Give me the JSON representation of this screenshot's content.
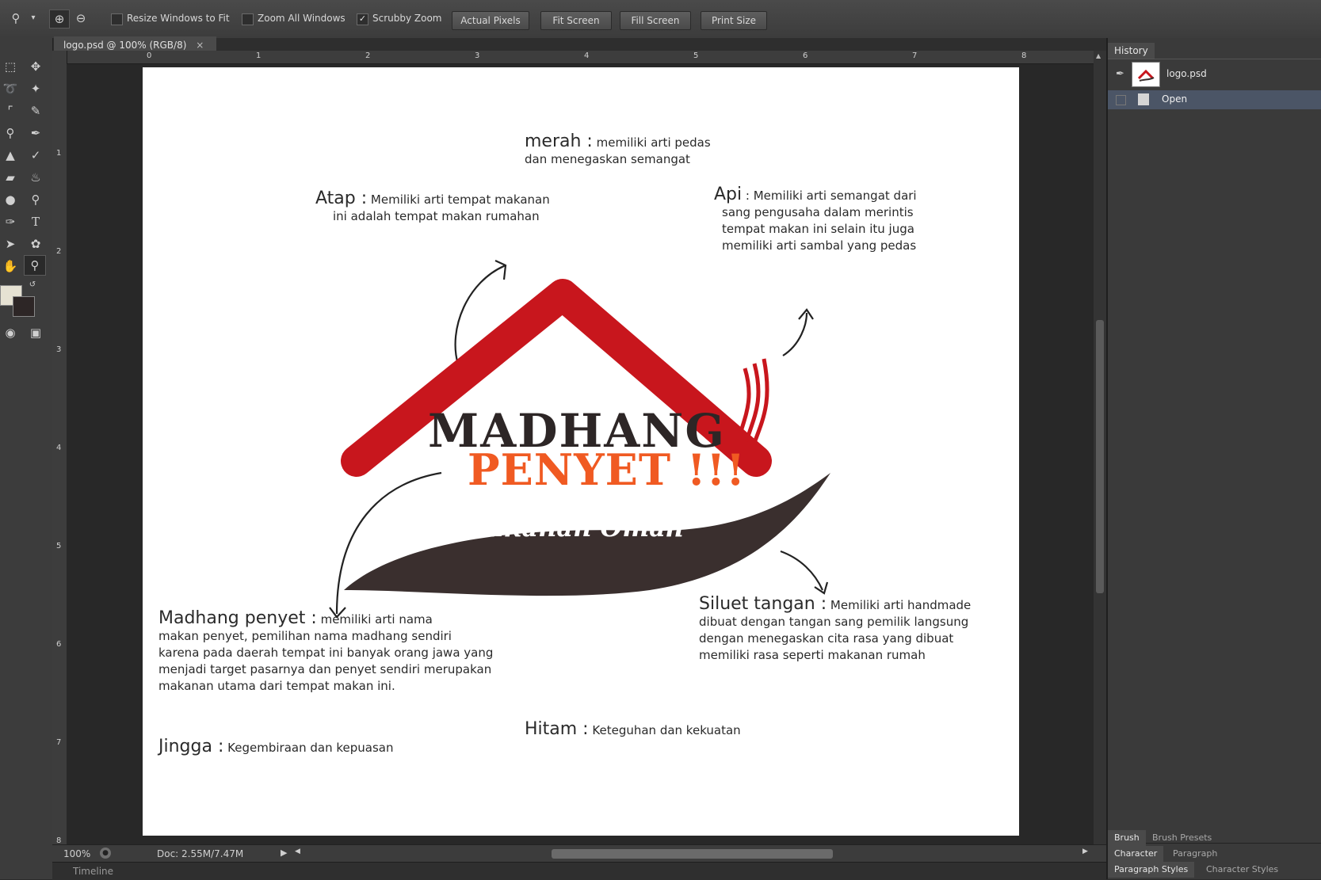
{
  "options_bar": {
    "resize_windows_label": "Resize Windows to Fit",
    "zoom_all_label": "Zoom All Windows",
    "scrubby_zoom_label": "Scrubby Zoom",
    "actual_pixels": "Actual Pixels",
    "fit_screen": "Fit Screen",
    "fill_screen": "Fill Screen",
    "print_size": "Print Size"
  },
  "document_tab": {
    "title": "logo.psd @ 100% (RGB/8)",
    "close": "×"
  },
  "ruler": {
    "h": [
      "0",
      "1",
      "2",
      "3",
      "4",
      "5",
      "6",
      "7",
      "8"
    ],
    "v": [
      "1",
      "2",
      "3",
      "4",
      "5",
      "6",
      "7",
      "8"
    ]
  },
  "status": {
    "zoom": "100%",
    "doc_size": "Doc: 2.55M/7.47M"
  },
  "timeline_label": "Timeline",
  "history": {
    "title": "History",
    "snapshot_name": "logo.psd",
    "state": "Open"
  },
  "bottom_panels": {
    "brush": "Brush",
    "brush_presets": "Brush Presets",
    "character": "Character",
    "paragraph": "Paragraph",
    "paragraph_styles": "Paragraph Styles",
    "character_styles": "Character Styles"
  },
  "logo": {
    "line1": "MADHANG",
    "line2": "PENYET !!!",
    "tagline": "Makanan Omah"
  },
  "annotations": {
    "merah_head": "merah :",
    "merah_l1": "memiliki arti pedas",
    "merah_l2": "dan menegaskan semangat",
    "atap_head": "Atap :",
    "atap_l1": "Memiliki arti tempat makanan",
    "atap_l2": "ini adalah tempat makan rumahan",
    "api_head": "Api",
    "api_l1": ": Memiliki arti semangat dari",
    "api_l2": "sang pengusaha dalam merintis",
    "api_l3": "tempat makan ini selain itu juga",
    "api_l4": "memiliki arti sambal yang pedas",
    "madhang_head": "Madhang penyet :",
    "madhang_l1": "memiliki arti nama",
    "madhang_l2": "makan penyet, pemilihan nama madhang sendiri",
    "madhang_l3": "karena pada daerah tempat ini banyak orang jawa yang",
    "madhang_l4": "menjadi target pasarnya dan penyet sendiri merupakan",
    "madhang_l5": "makanan utama dari tempat makan ini.",
    "jingga_head": "Jingga :",
    "jingga_l1": "Kegembiraan dan kepuasan",
    "siluet_head": "Siluet tangan :",
    "siluet_l1": "Memiliki arti handmade",
    "siluet_l2": "dibuat dengan tangan sang pemilik langsung",
    "siluet_l3": "dengan menegaskan cita rasa yang dibuat",
    "siluet_l4": "memiliki rasa seperti makanan rumah",
    "hitam_head": "Hitam :",
    "hitam_l1": "Keteguhan dan kekuatan"
  },
  "colors": {
    "roof_red": "#c8161d",
    "penyet_orange": "#f05a22",
    "madhang_dark": "#2d2626",
    "swoosh_brown": "#3a2f2e"
  }
}
